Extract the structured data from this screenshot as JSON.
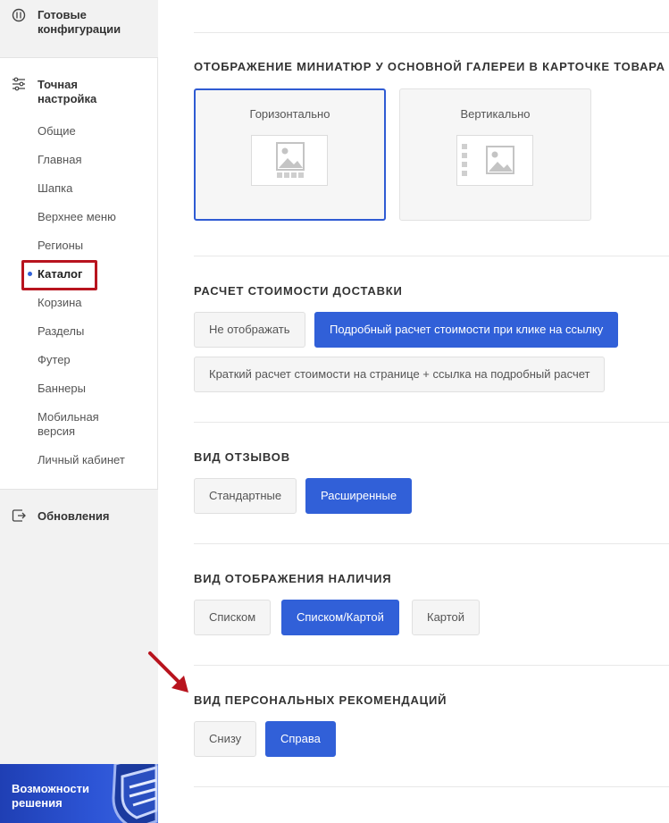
{
  "sidebar": {
    "ready_configs": "Готовые конфигурации",
    "fine_tuning": "Точная настройка",
    "items": [
      {
        "label": "Общие"
      },
      {
        "label": "Главная"
      },
      {
        "label": "Шапка"
      },
      {
        "label": "Верхнее меню"
      },
      {
        "label": "Регионы"
      },
      {
        "label": "Каталог",
        "active": true
      },
      {
        "label": "Корзина"
      },
      {
        "label": "Разделы"
      },
      {
        "label": "Футер"
      },
      {
        "label": "Баннеры"
      },
      {
        "label": "Мобильная версия"
      },
      {
        "label": "Личный кабинет"
      }
    ],
    "updates": "Обновления",
    "banner": "Возможности решения"
  },
  "sections": {
    "thumbnails": {
      "title": "Отображение миниатюр у основной галереи в карточке товара",
      "options": [
        {
          "label": "Горизонтально",
          "selected": true
        },
        {
          "label": "Вертикально",
          "selected": false
        }
      ]
    },
    "delivery": {
      "title": "Расчет стоимости доставки",
      "options": [
        {
          "label": "Не отображать",
          "selected": false
        },
        {
          "label": "Подробный расчет стоимости при клике на ссылку",
          "selected": true
        },
        {
          "label": "Краткий расчет стоимости на странице + ссылка на подробный расчет",
          "selected": false
        }
      ]
    },
    "reviews": {
      "title": "Вид отзывов",
      "options": [
        {
          "label": "Стандартные",
          "selected": false
        },
        {
          "label": "Расширенные",
          "selected": true
        }
      ]
    },
    "availability": {
      "title": "Вид отображения наличия",
      "options": [
        {
          "label": "Списком",
          "selected": false
        },
        {
          "label": "Списком/Картой",
          "selected": true
        },
        {
          "label": "Картой",
          "selected": false
        }
      ]
    },
    "recommendations": {
      "title": "Вид персональных рекомендаций",
      "options": [
        {
          "label": "Снизу",
          "selected": false
        },
        {
          "label": "Справа",
          "selected": true
        }
      ]
    }
  },
  "colors": {
    "accent": "#3160d8",
    "highlight": "#b8141e"
  },
  "icons": {
    "ready_configs": "configs-circle-icon",
    "fine_tuning": "sliders-icon",
    "updates": "update-icon",
    "banner": "shield-logo-icon",
    "thumb": "image-placeholder-icon",
    "annotation": "red-arrow-icon"
  }
}
